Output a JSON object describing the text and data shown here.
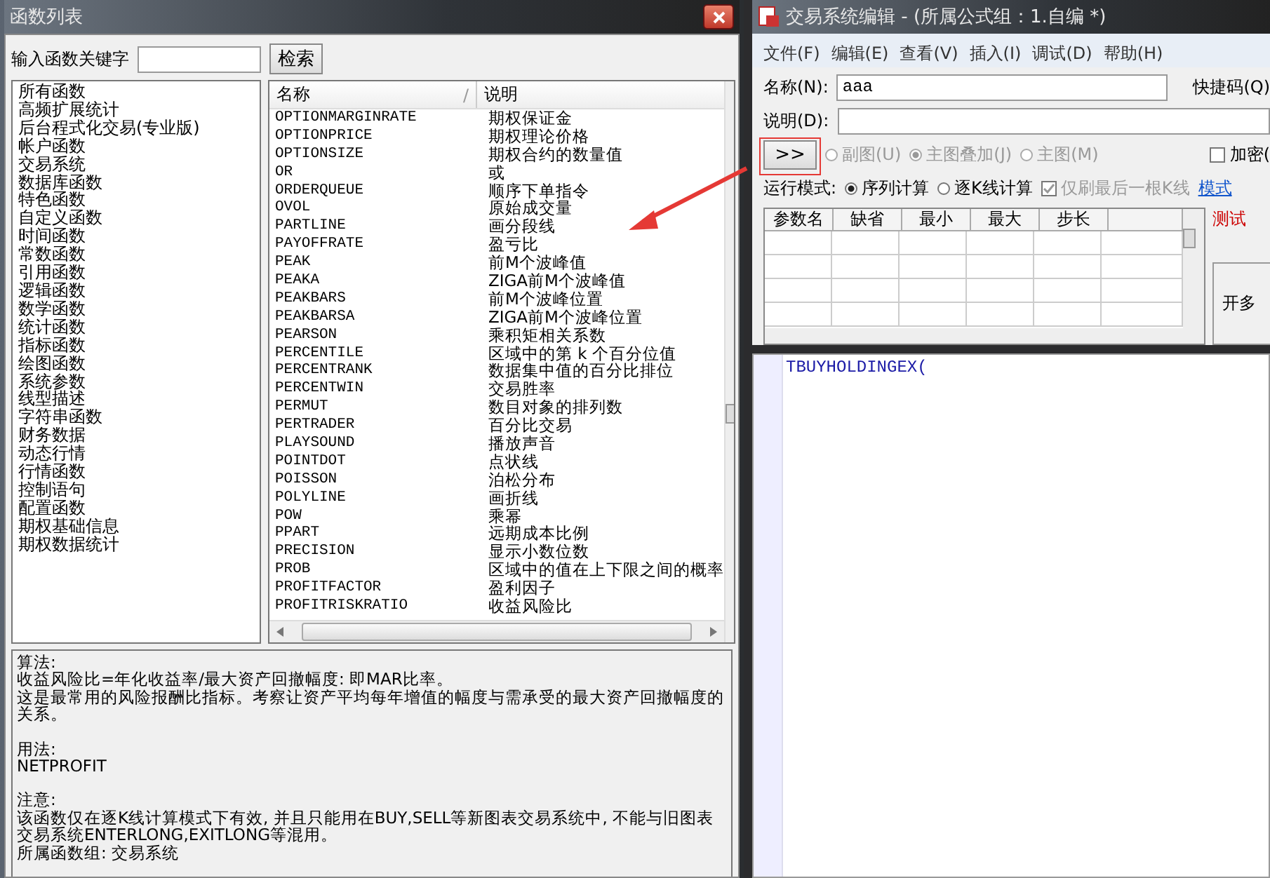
{
  "function_window": {
    "title": "函数列表",
    "search": {
      "label": "输入函数关键字",
      "button": "检索"
    },
    "categories": [
      "所有函数",
      "高频扩展统计",
      "后台程式化交易(专业版)",
      "帐户函数",
      "交易系统",
      "数据库函数",
      "特色函数",
      "自定义函数",
      "时间函数",
      "常数函数",
      "引用函数",
      "逻辑函数",
      "数学函数",
      "统计函数",
      "指标函数",
      "绘图函数",
      "系统参数",
      "线型描述",
      "字符串函数",
      "财务数据",
      "动态行情",
      "行情函数",
      "控制语句",
      "配置函数",
      "期权基础信息",
      "期权数据统计"
    ],
    "table": {
      "columns": [
        {
          "label": "名称",
          "sort_mark": "/"
        },
        {
          "label": "说明"
        }
      ],
      "rows": [
        [
          "OPTIONMARGINRATE",
          "期权保证金"
        ],
        [
          "OPTIONPRICE",
          "期权理论价格"
        ],
        [
          "OPTIONSIZE",
          "期权合约的数量值"
        ],
        [
          "OR",
          "或"
        ],
        [
          "ORDERQUEUE",
          "顺序下单指令"
        ],
        [
          "OVOL",
          "原始成交量"
        ],
        [
          "PARTLINE",
          "画分段线"
        ],
        [
          "PAYOFFRATE",
          "盈亏比"
        ],
        [
          "PEAK",
          "前M个波峰值"
        ],
        [
          "PEAKA",
          "ZIGA前M个波峰值"
        ],
        [
          "PEAKBARS",
          "前M个波峰位置"
        ],
        [
          "PEAKBARSA",
          "ZIGA前M个波峰位置"
        ],
        [
          "PEARSON",
          "乘积矩相关系数"
        ],
        [
          "PERCENTILE",
          "区域中的第 k 个百分位值"
        ],
        [
          "PERCENTRANK",
          "数据集中值的百分比排位"
        ],
        [
          "PERCENTWIN",
          "交易胜率"
        ],
        [
          "PERMUT",
          "数目对象的排列数"
        ],
        [
          "PERTRADER",
          "百分比交易"
        ],
        [
          "PLAYSOUND",
          "播放声音"
        ],
        [
          "POINTDOT",
          "点状线"
        ],
        [
          "POISSON",
          "泊松分布"
        ],
        [
          "POLYLINE",
          "画折线"
        ],
        [
          "POW",
          "乘幂"
        ],
        [
          "PPART",
          "远期成本比例"
        ],
        [
          "PRECISION",
          "显示小数位数"
        ],
        [
          "PROB",
          "区域中的值在上下限之间的概率"
        ],
        [
          "PROFITFACTOR",
          "盈利因子"
        ],
        [
          "PROFITRISKRATIO",
          "收益风险比"
        ]
      ]
    },
    "description": [
      {
        "heading": "算法:",
        "lines": [
          "收益风险比=年化收益率/最大资产回撤幅度: 即MAR比率。",
          "这是最常用的风险报酬比指标。考察让资产平均每年增值的幅度与需承受的最大资产回撤幅度的关系。"
        ]
      },
      {
        "heading": "用法:",
        "lines": [
          "NETPROFIT"
        ]
      },
      {
        "heading": "注意:",
        "lines": [
          "该函数仅在逐K线计算模式下有效, 并且只能用在BUY,SELL等新图表交易系统中, 不能与旧图表交易系统ENTERLONG,EXITLONG等混用。",
          "所属函数组: 交易系统"
        ]
      }
    ]
  },
  "editor_window": {
    "title": "交易系统编辑 - (所属公式组：1.自编 *)",
    "menu": [
      "文件(F)",
      "编辑(E)",
      "查看(V)",
      "插入(I)",
      "调试(D)",
      "帮助(H)"
    ],
    "name_field": {
      "label": "名称(N):",
      "value": "aaa"
    },
    "shortcut_label": "快捷码(Q)",
    "description_field": {
      "label": "说明(D):"
    },
    "expand_button": ">>",
    "chart_options": [
      {
        "label": "副图(U)",
        "selected": false,
        "disabled": true
      },
      {
        "label": "主图叠加(J)",
        "selected": true,
        "disabled": true
      },
      {
        "label": "主图(M)",
        "selected": false,
        "disabled": true
      }
    ],
    "encrypt": {
      "label": "加密(",
      "checked": false
    },
    "run_mode": {
      "label": "运行模式:",
      "options": [
        {
          "label": "序列计算",
          "selected": true,
          "disabled": false
        },
        {
          "label": "逐K线计算",
          "selected": false,
          "disabled": false
        }
      ],
      "refresh_last": {
        "label": "仅刷最后一根K线",
        "checked": true,
        "disabled": true
      }
    },
    "mode_link": "模式",
    "params_table": {
      "columns": [
        "参数名",
        "缺省",
        "最小",
        "最大",
        "步长"
      ]
    },
    "test_status": "测试",
    "side_button": "开多",
    "code": "TBUYHOLDINGEX("
  }
}
